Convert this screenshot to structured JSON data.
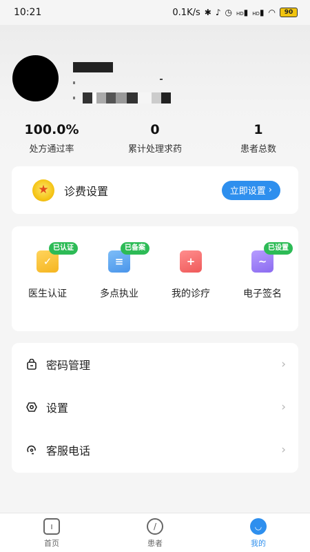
{
  "status_bar": {
    "time": "10:21",
    "network_speed": "0.1K/s",
    "signal_1": "HD",
    "signal_2": "HD",
    "battery": "90"
  },
  "profile": {
    "stats": [
      {
        "value": "100.0%",
        "label": "处方通过率"
      },
      {
        "value": "0",
        "label": "累计处理求药"
      },
      {
        "value": "1",
        "label": "患者总数"
      }
    ]
  },
  "fee_card": {
    "title": "诊费设置",
    "button_label": "立即设置"
  },
  "features": [
    {
      "label": "医生认证",
      "badge": "已认证",
      "color": "#f5b520"
    },
    {
      "label": "多点执业",
      "badge": "已备案",
      "color": "#4a95ea"
    },
    {
      "label": "我的诊疗",
      "badge": "",
      "color": "#ef5a5a"
    },
    {
      "label": "电子签名",
      "badge": "已设置",
      "color": "#8b6bf0"
    }
  ],
  "menu": [
    {
      "label": "密码管理",
      "icon": "lock-icon"
    },
    {
      "label": "设置",
      "icon": "settings-icon"
    },
    {
      "label": "客服电话",
      "icon": "headset-icon"
    }
  ],
  "bottom_nav": [
    {
      "label": "首页",
      "icon": "home-icon",
      "active": false
    },
    {
      "label": "患者",
      "icon": "patients-icon",
      "active": false
    },
    {
      "label": "我的",
      "icon": "me-icon",
      "active": true
    }
  ],
  "colors": {
    "accent": "#2e8fee",
    "badge_green": "#2dbb56",
    "background": "#f5f5f5"
  }
}
